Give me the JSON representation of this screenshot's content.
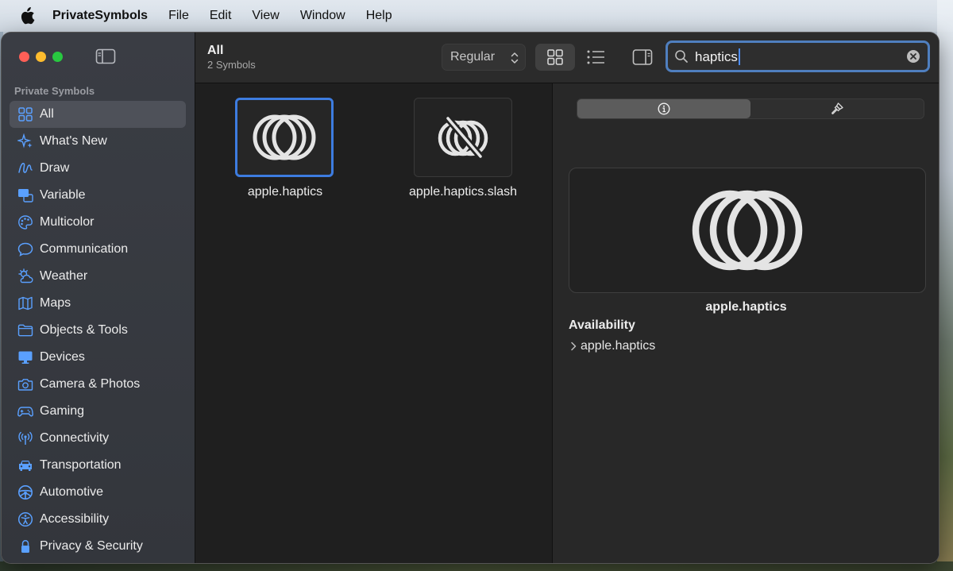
{
  "menubar": {
    "app_name": "PrivateSymbols",
    "items": [
      "File",
      "Edit",
      "View",
      "Window",
      "Help"
    ]
  },
  "sidebar": {
    "heading": "Private Symbols",
    "items": [
      {
        "label": "All",
        "icon": "grid-icon",
        "selected": true
      },
      {
        "label": "What's New",
        "icon": "sparkles-icon"
      },
      {
        "label": "Draw",
        "icon": "scribble-icon"
      },
      {
        "label": "Variable",
        "icon": "variable-icon"
      },
      {
        "label": "Multicolor",
        "icon": "palette-icon"
      },
      {
        "label": "Communication",
        "icon": "message-bubble-icon"
      },
      {
        "label": "Weather",
        "icon": "cloud-sun-icon"
      },
      {
        "label": "Maps",
        "icon": "map-icon"
      },
      {
        "label": "Objects & Tools",
        "icon": "folder-icon"
      },
      {
        "label": "Devices",
        "icon": "display-icon"
      },
      {
        "label": "Camera & Photos",
        "icon": "camera-icon"
      },
      {
        "label": "Gaming",
        "icon": "gamecontroller-icon"
      },
      {
        "label": "Connectivity",
        "icon": "antenna-icon"
      },
      {
        "label": "Transportation",
        "icon": "car-icon"
      },
      {
        "label": "Automotive",
        "icon": "steering-wheel-icon"
      },
      {
        "label": "Accessibility",
        "icon": "accessibility-icon"
      },
      {
        "label": "Privacy & Security",
        "icon": "lock-icon"
      }
    ]
  },
  "toolbar": {
    "title": "All",
    "subtitle": "2 Symbols",
    "weight": "Regular",
    "search_value": "haptics"
  },
  "symbols": [
    {
      "name": "apple.haptics",
      "selected": true
    },
    {
      "name": "apple.haptics.slash",
      "selected": false
    }
  ],
  "inspector": {
    "symbol_name": "apple.haptics",
    "availability_title": "Availability",
    "availability_item": "apple.haptics"
  },
  "colors": {
    "accent": "#3d7ce0",
    "sidebar_selected": "#4e5159"
  }
}
